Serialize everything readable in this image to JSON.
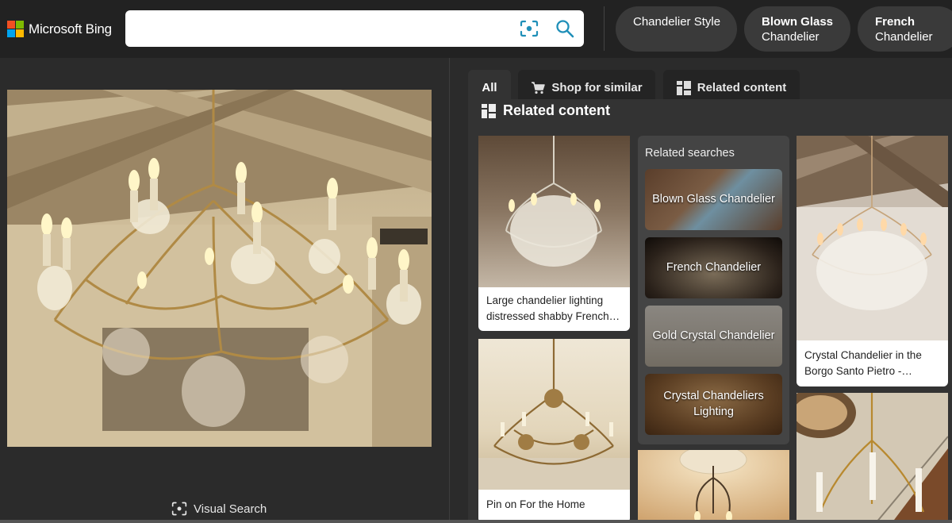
{
  "header": {
    "logo_text": "Microsoft Bing",
    "logo_colors": [
      "#f25022",
      "#7fba00",
      "#00a4ef",
      "#ffb900"
    ],
    "search_value": "",
    "search_placeholder": "",
    "visual_search_icon": "camera-scan-icon",
    "search_icon": "magnifier-icon",
    "icon_color": "#1f8fb8",
    "chips": [
      {
        "line1": "Chandelier Style",
        "line2": ""
      },
      {
        "line1": "Blown Glass",
        "line2": "Chandelier"
      },
      {
        "line1": "French",
        "line2": "Chandelier"
      }
    ]
  },
  "left_pane": {
    "image_alt": "Gold crystal chandelier with candle lights under a wood beam ceiling",
    "visual_search_label": "Visual Search"
  },
  "tabs": [
    {
      "label": "All",
      "icon": "",
      "active": true
    },
    {
      "label": "Shop for similar",
      "icon": "cart-icon",
      "active": false
    },
    {
      "label": "Related content",
      "icon": "grid-icon",
      "active": false
    }
  ],
  "related_content": {
    "title": "Related content",
    "cards": [
      {
        "caption": "Large chandelier lighting distressed shabby French…",
        "image": "white-crystal-chandelier"
      },
      {
        "caption": "Pin on For the Home",
        "image": "gold-leaf-chandelier"
      },
      {
        "caption": "",
        "image": "ceiling-medallion-chandelier"
      },
      {
        "caption": "Crystal Chandelier in the Borgo Santo Pietro -…",
        "image": "crystal-chandelier-wood-ceiling"
      },
      {
        "caption": "",
        "image": "gold-chandelier-staircase"
      }
    ],
    "related_searches": {
      "title": "Related searches",
      "items": [
        {
          "label": "Blown Glass Chandelier"
        },
        {
          "label": "French Chandelier"
        },
        {
          "label": "Gold Crystal Chandelier"
        },
        {
          "label": "Crystal Chandeliers Lighting"
        }
      ]
    }
  }
}
